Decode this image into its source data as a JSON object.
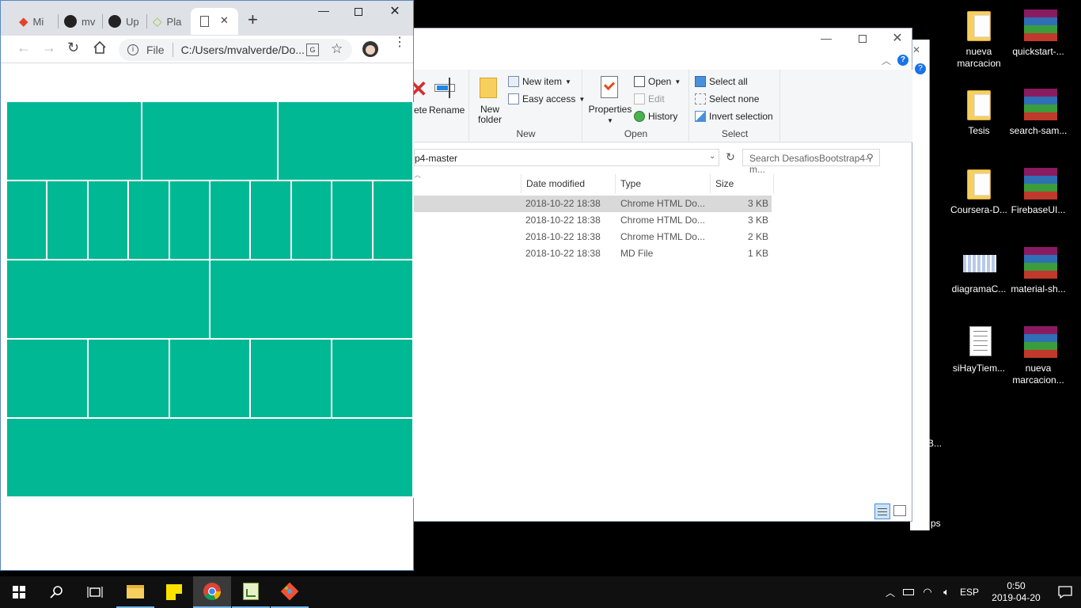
{
  "desktop": {
    "icons": [
      {
        "label": "nueva marcacion",
        "type": "folder"
      },
      {
        "label": "quickstart-...",
        "type": "winrar"
      },
      {
        "label": "Tesis",
        "type": "folder"
      },
      {
        "label": "search-sam...",
        "type": "winrar"
      },
      {
        "label": "Coursera-D...",
        "type": "folder"
      },
      {
        "label": "FirebaseUI...",
        "type": "winrar"
      },
      {
        "label": "diagramaC...",
        "type": "image"
      },
      {
        "label": "material-sh...",
        "type": "winrar"
      },
      {
        "label": "siHayTiem...",
        "type": "text-file"
      },
      {
        "label": "nueva marcacion...",
        "type": "winrar"
      }
    ],
    "behind_fragments": {
      "a": "B...",
      "b": "ps"
    }
  },
  "explorer": {
    "ribbon": {
      "organize": {
        "delete_label": "ete",
        "rename_label": "Rename"
      },
      "new_group": {
        "new_folder_label": "New folder",
        "new_item_label": "New item",
        "easy_access_label": "Easy access",
        "group_label": "New"
      },
      "open_group": {
        "properties_label": "Properties",
        "open_label": "Open",
        "edit_label": "Edit",
        "history_label": "History",
        "group_label": "Open"
      },
      "select_group": {
        "select_all_label": "Select all",
        "select_none_label": "Select none",
        "invert_label": "Invert selection",
        "group_label": "Select"
      }
    },
    "address_tail": "p4-master",
    "search_placeholder": "Search DesafiosBootstrap4-m...",
    "columns": {
      "date": "Date modified",
      "type": "Type",
      "size": "Size"
    },
    "rows": [
      {
        "date": "2018-10-22 18:38",
        "type": "Chrome HTML Do...",
        "size": "3 KB",
        "selected": true
      },
      {
        "date": "2018-10-22 18:38",
        "type": "Chrome HTML Do...",
        "size": "3 KB",
        "selected": false
      },
      {
        "date": "2018-10-22 18:38",
        "type": "Chrome HTML Do...",
        "size": "2 KB",
        "selected": false
      },
      {
        "date": "2018-10-22 18:38",
        "type": "MD File",
        "size": "1 KB",
        "selected": false
      }
    ]
  },
  "chrome": {
    "tabs": [
      {
        "title": "Mi",
        "icon": "gitlab-icon"
      },
      {
        "title": "mv",
        "icon": "github-icon"
      },
      {
        "title": "Up",
        "icon": "github-icon"
      },
      {
        "title": "Pla",
        "icon": "platzi-icon"
      },
      {
        "title": "",
        "icon": "file-icon",
        "active": true
      }
    ],
    "omnibox": {
      "scheme_label": "File",
      "url": "C:/Users/mvalverde/Do..."
    },
    "page": {
      "grid_color": "#00b894",
      "rows": [
        {
          "columns": 3
        },
        {
          "columns": 10
        },
        {
          "columns": 2
        },
        {
          "columns": 5
        },
        {
          "columns": 1
        }
      ]
    }
  },
  "taskbar": {
    "apps": [
      "file-explorer-icon",
      "sticky-notes-icon",
      "chrome-icon",
      "task-manager-icon",
      "git-icon"
    ],
    "language": "ESP",
    "time": "0:50",
    "date": "2019-04-20"
  }
}
